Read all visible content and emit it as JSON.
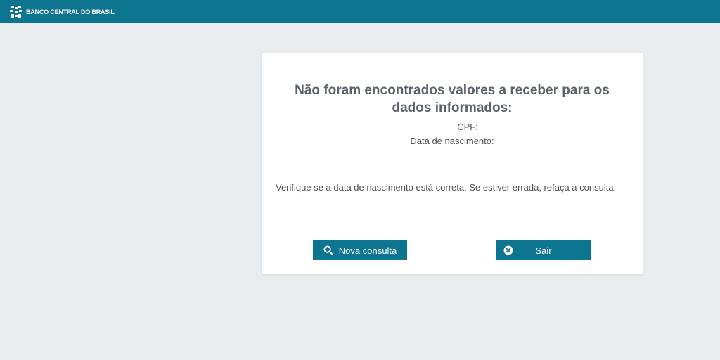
{
  "header": {
    "brand": "BANCO CENTRAL DO BRASIL",
    "logo_icon": "bcb-logo-icon",
    "background_color": "#0e7590"
  },
  "result": {
    "title": "Não foram encontrados valores a receber para os dados informados:",
    "cpf_label": "CPF:",
    "birth_label": "Data de nascimento:",
    "message": "Verifique se a data de nascimento está correta. Se estiver errada, refaça a consulta."
  },
  "actions": {
    "new_query_label": "Nova consulta",
    "new_query_icon": "search-icon",
    "exit_label": "Sair",
    "exit_icon": "close-circle-icon"
  },
  "colors": {
    "accent": "#0e7590",
    "page_background": "#e9ecee",
    "card_background": "#ffffff"
  }
}
